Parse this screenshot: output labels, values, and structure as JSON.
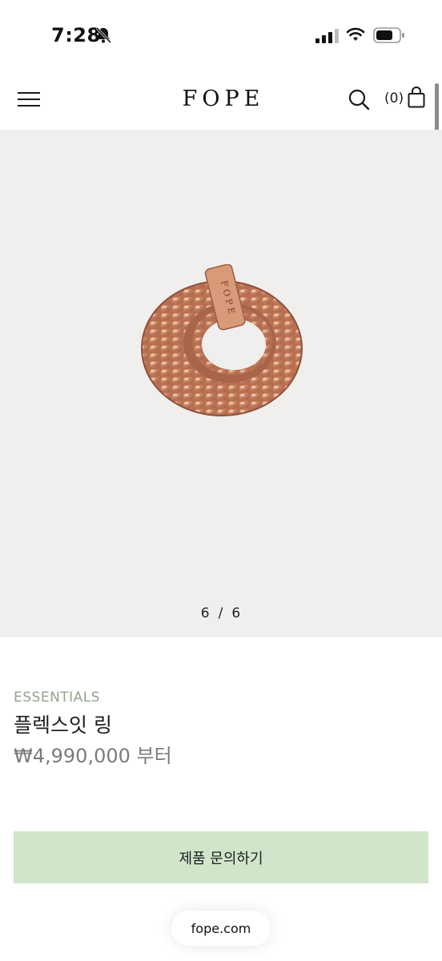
{
  "status_bar": {
    "time": "7:28",
    "icons": [
      "bell-slash-icon",
      "cellular-signal-icon",
      "wifi-icon",
      "battery-icon"
    ]
  },
  "header": {
    "logo": "FOPE",
    "cart_count": "(0)",
    "icons": [
      "menu-icon",
      "search-icon",
      "shopping-bag-icon"
    ]
  },
  "gallery": {
    "current": "6",
    "separator": "/",
    "total": "6",
    "background": "#f0efed"
  },
  "product": {
    "category": "ESSENTIALS",
    "name": "플렉스잇 링",
    "price": "₩4,990,000 부터"
  },
  "actions": {
    "inquiry_label": "제품 문의하기"
  },
  "browser": {
    "url": "fope.com"
  },
  "colors": {
    "accent_green": "#cfe6cb",
    "category_green": "#93a58a",
    "price_gray": "#7b7b7b",
    "ring_gold": "#c9876a"
  }
}
